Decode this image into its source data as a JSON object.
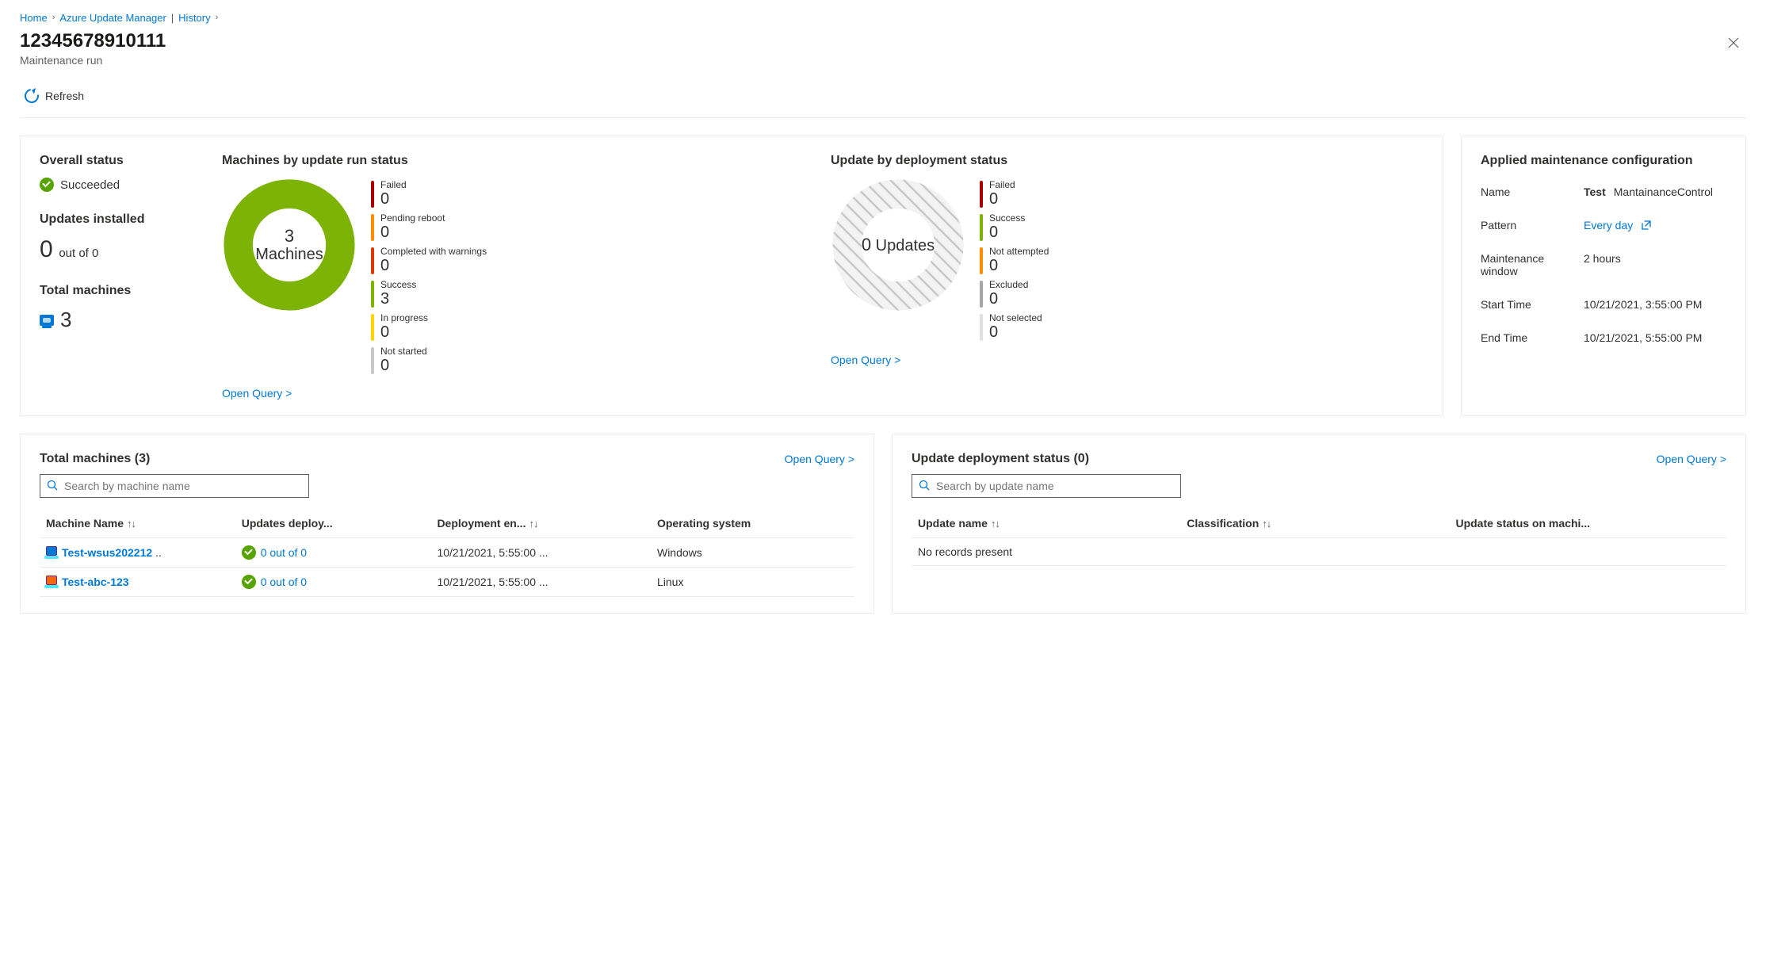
{
  "breadcrumb": {
    "home": "Home",
    "mgr": "Azure Update Manager",
    "hist": "History"
  },
  "header": {
    "title": "12345678910111",
    "subtitle": "Maintenance run"
  },
  "toolbar": {
    "refresh": "Refresh"
  },
  "overview": {
    "overall_status_title": "Overall status",
    "overall_status_value": "Succeeded",
    "updates_installed_title": "Updates installed",
    "updates_installed_num": "0",
    "updates_installed_sub": "out of 0",
    "total_machines_title": "Total machines",
    "total_machines_num": "3"
  },
  "machines_chart": {
    "title": "Machines by update run status",
    "center_num": "3",
    "center_text": "Machines",
    "legend": [
      {
        "label": "Failed",
        "value": "0",
        "color": "#a80000"
      },
      {
        "label": "Pending reboot",
        "value": "0",
        "color": "#ff8c00"
      },
      {
        "label": "Completed with warnings",
        "value": "0",
        "color": "#d83b01"
      },
      {
        "label": "Success",
        "value": "3",
        "color": "#7cb305"
      },
      {
        "label": "In progress",
        "value": "0",
        "color": "#ffd400"
      },
      {
        "label": "Not started",
        "value": "0",
        "color": "#c8c8c8"
      }
    ],
    "open_query": "Open Query  >"
  },
  "updates_chart": {
    "title": "Update by deployment status",
    "center_num": "0",
    "center_text": "Updates",
    "legend": [
      {
        "label": "Failed",
        "value": "0",
        "color": "#a80000"
      },
      {
        "label": "Success",
        "value": "0",
        "color": "#7cb305"
      },
      {
        "label": "Not attempted",
        "value": "0",
        "color": "#ff8c00"
      },
      {
        "label": "Excluded",
        "value": "0",
        "color": "#a6a6a6"
      },
      {
        "label": "Not selected",
        "value": "0",
        "color": "#e0e0e0"
      }
    ],
    "open_query": "Open Query  >"
  },
  "config": {
    "title": "Applied maintenance configuration",
    "name_label": "Name",
    "name_bold": "Test",
    "name_rest": "MantainanceControl",
    "pattern_label": "Pattern",
    "pattern_value": "Every day",
    "window_label": "Maintenance window",
    "window_value": "2 hours",
    "start_label": "Start Time",
    "start_value": "10/21/2021, 3:55:00 PM",
    "end_label": "End Time",
    "end_value": "10/21/2021, 5:55:00 PM"
  },
  "machines_table": {
    "title": "Total machines (3)",
    "open_query": "Open Query  >",
    "search_placeholder": "Search by machine name",
    "cols": {
      "name": "Machine Name",
      "deployed": "Updates deploy...",
      "end": "Deployment en...",
      "os": "Operating system"
    },
    "rows": [
      {
        "icon": "win",
        "name": "Test-wsus202212",
        "trail": " ..",
        "deployed": "0 out of 0",
        "end": "10/21/2021, 5:55:00 ...",
        "os": "Windows"
      },
      {
        "icon": "lin",
        "name": "Test-abc-123",
        "trail": "",
        "deployed": "0 out of 0",
        "end": "10/21/2021, 5:55:00 ...",
        "os": "Linux"
      }
    ]
  },
  "updates_table": {
    "title": "Update deployment status (0)",
    "open_query": "Open Query  >",
    "search_placeholder": "Search by update name",
    "cols": {
      "name": "Update name",
      "class": "Classification",
      "status": "Update status on machi..."
    },
    "empty": "No records present"
  },
  "chart_data": [
    {
      "type": "pie",
      "title": "Machines by update run status",
      "categories": [
        "Failed",
        "Pending reboot",
        "Completed with warnings",
        "Success",
        "In progress",
        "Not started"
      ],
      "values": [
        0,
        0,
        0,
        3,
        0,
        0
      ],
      "total_label": "3 Machines"
    },
    {
      "type": "pie",
      "title": "Update by deployment status",
      "categories": [
        "Failed",
        "Success",
        "Not attempted",
        "Excluded",
        "Not selected"
      ],
      "values": [
        0,
        0,
        0,
        0,
        0
      ],
      "total_label": "0 Updates"
    }
  ]
}
